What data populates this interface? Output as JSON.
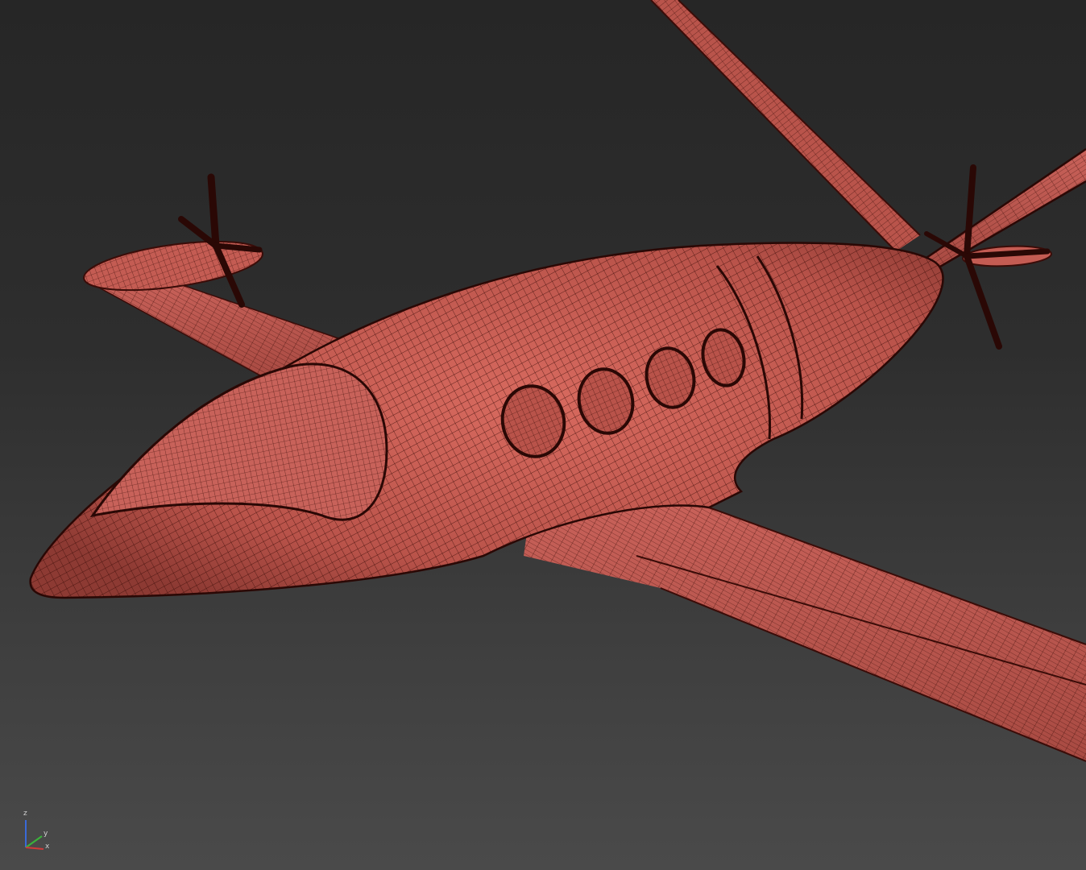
{
  "viewport": {
    "background_top": "#262626",
    "background_bottom": "#4a4a4a",
    "model": {
      "name": "electric-aircraft-wireframe",
      "surface_color": "#c2574e",
      "wire_color": "#3a0c08",
      "parts": [
        "fuselage",
        "cockpit-canopy",
        "cabin-windows",
        "left-wing",
        "right-wing",
        "left-nacelle",
        "right-nacelle",
        "left-propeller",
        "right-propeller",
        "tail-boom"
      ],
      "cabin_window_count": 4
    }
  },
  "axis_gizmo": {
    "z_label": "z",
    "y_label": "y",
    "x_label": "x",
    "x_color": "#d03a3a",
    "y_color": "#3ab43a",
    "z_color": "#3a6ad8"
  }
}
